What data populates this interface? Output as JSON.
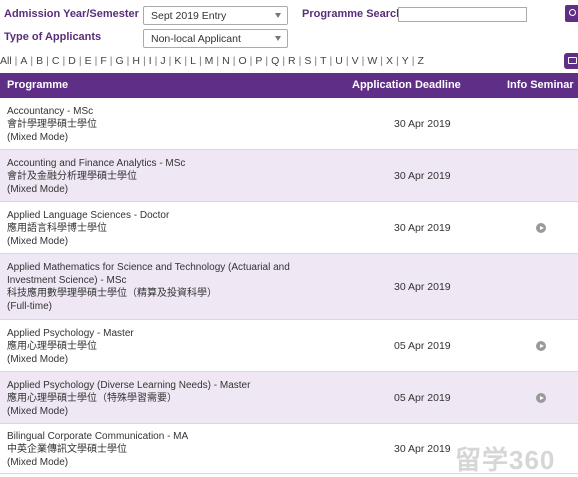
{
  "filters": {
    "admission_label": "Admission Year/Semester",
    "admission_value": "Sept 2019 Entry",
    "applicant_type_label": "Type of Applicants",
    "applicant_type_value": "Non-local Applicant",
    "search_label": "Programme Search",
    "search_value": ""
  },
  "alphabet": [
    "All",
    "A",
    "B",
    "C",
    "D",
    "E",
    "F",
    "G",
    "H",
    "I",
    "J",
    "K",
    "L",
    "M",
    "N",
    "O",
    "P",
    "Q",
    "R",
    "S",
    "T",
    "U",
    "V",
    "W",
    "X",
    "Y",
    "Z"
  ],
  "table": {
    "headers": {
      "programme": "Programme",
      "deadline": "Application Deadline",
      "seminar": "Info Seminar"
    },
    "rows": [
      {
        "lines": [
          "Accountancy - MSc",
          "會計學理學碩士學位",
          "(Mixed Mode)"
        ],
        "deadline": "30 Apr 2019",
        "seminar": false
      },
      {
        "lines": [
          "Accounting and Finance Analytics - MSc",
          "會計及金融分析理學碩士學位",
          "(Mixed Mode)"
        ],
        "deadline": "30 Apr 2019",
        "seminar": false
      },
      {
        "lines": [
          "Applied Language Sciences - Doctor",
          "應用語言科學博士學位",
          "(Mixed Mode)"
        ],
        "deadline": "30 Apr 2019",
        "seminar": true
      },
      {
        "lines": [
          "Applied Mathematics for Science and Technology (Actuarial and Investment Science) - MSc",
          "科技應用數學理學碩士學位（精算及投資科學）",
          "(Full-time)"
        ],
        "deadline": "30 Apr 2019",
        "seminar": false
      },
      {
        "lines": [
          "Applied Psychology - Master",
          "應用心理學碩士學位",
          "(Mixed Mode)"
        ],
        "deadline": "05 Apr 2019",
        "seminar": true
      },
      {
        "lines": [
          "Applied Psychology (Diverse Learning Needs) - Master",
          "應用心理學碩士學位（特殊學習需要）",
          "(Mixed Mode)"
        ],
        "deadline": "05 Apr 2019",
        "seminar": true
      },
      {
        "lines": [
          "Bilingual Corporate Communication - MA",
          "中英企業傳訊文學碩士學位",
          "(Mixed Mode)"
        ],
        "deadline": "30 Apr 2019",
        "seminar": false
      }
    ]
  },
  "watermark": "留学360",
  "colors": {
    "accent": "#5f2e86",
    "row_alt": "#efe7f4",
    "label": "#5a2d7a"
  },
  "icons": {
    "search_button": "search-icon",
    "print_button": "print-icon",
    "seminar": "play-icon"
  }
}
